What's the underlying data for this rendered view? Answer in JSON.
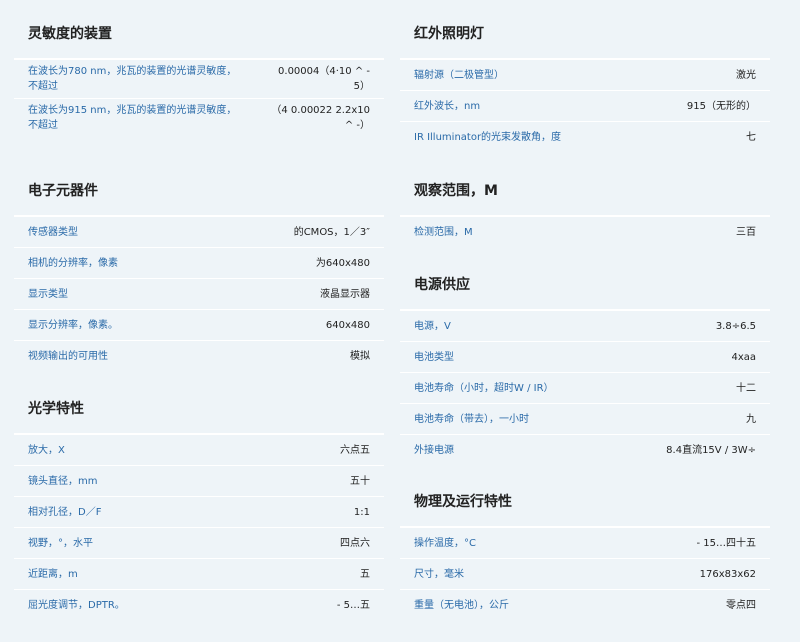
{
  "sections_left": [
    {
      "title": "灵敏度的装置",
      "rows": [
        {
          "label": "在波长为780 nm，兆瓦的装置的光谱灵敏度，不超过",
          "value": "0.00004（4·10 ^ - 5）"
        },
        {
          "label": "在波长为915 nm，兆瓦的装置的光谱灵敏度，不超过",
          "value": "（4 0.00022 2.2x10 ^ -）"
        }
      ]
    },
    {
      "title": "电子元器件",
      "rows": [
        {
          "label": "传感器类型",
          "value": "的CMOS，1／3″"
        },
        {
          "label": "相机的分辨率，像素",
          "value": "为640x480"
        },
        {
          "label": "显示类型",
          "value": "液晶显示器"
        },
        {
          "label": "显示分辨率，像素。",
          "value": "640x480"
        },
        {
          "label": "视频输出的可用性",
          "value": "模拟"
        }
      ]
    },
    {
      "title": "光学特性",
      "rows": [
        {
          "label": "放大，X",
          "value": "六点五"
        },
        {
          "label": "镜头直径，mm",
          "value": "五十"
        },
        {
          "label": "相对孔径，D／F",
          "value": "1:1"
        },
        {
          "label": "视野，°，水平",
          "value": "四点六"
        },
        {
          "label": "近距离，m",
          "value": "五"
        },
        {
          "label": "屈光度调节，DPTR。",
          "value": "- 5…五"
        }
      ]
    }
  ],
  "sections_right": [
    {
      "title": "红外照明灯",
      "rows": [
        {
          "label": "辐射源（二极管型）",
          "value": "激光"
        },
        {
          "label": "红外波长，nm",
          "value": "915（无形的）"
        },
        {
          "label": "IR Illuminator的光束发散角，度",
          "value": "七"
        }
      ]
    },
    {
      "title": "观察范围，M",
      "rows": [
        {
          "label": "检测范围，M",
          "value": "三百"
        }
      ]
    },
    {
      "title": "电源供应",
      "rows": [
        {
          "label": "电源，V",
          "value": "3.8÷6.5"
        },
        {
          "label": "电池类型",
          "value": "4xaa"
        },
        {
          "label": "电池寿命（小时，超时W / IR）",
          "value": "十二"
        },
        {
          "label": "电池寿命（带去），一小时",
          "value": "九"
        },
        {
          "label": "外接电源",
          "value": "8.4直流15V / 3W÷"
        }
      ]
    },
    {
      "title": "物理及运行特性",
      "rows": [
        {
          "label": "操作温度，°C",
          "value": "- 15…四十五"
        },
        {
          "label": "尺寸，毫米",
          "value": "176x83x62"
        },
        {
          "label": "重量（无电池），公斤",
          "value": "零点四"
        }
      ]
    }
  ]
}
